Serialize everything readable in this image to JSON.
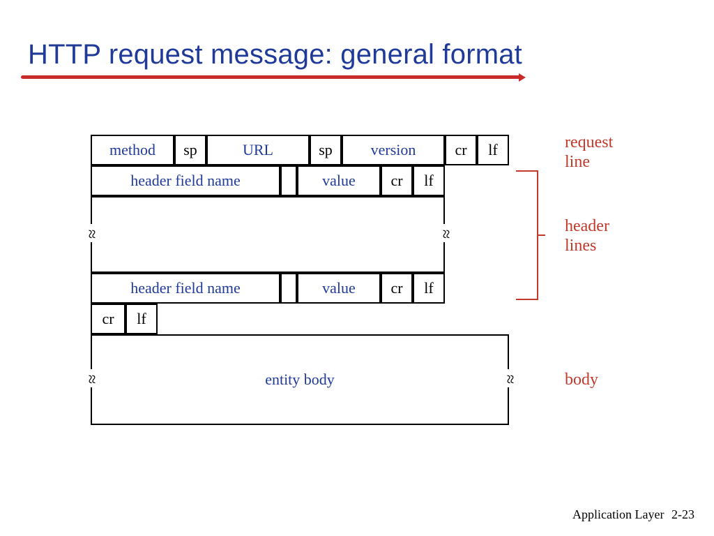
{
  "title": "HTTP request message: general format",
  "row1": {
    "method": "method",
    "sp1": "sp",
    "url": "URL",
    "sp2": "sp",
    "version": "version",
    "cr": "cr",
    "lf": "lf"
  },
  "header1": {
    "name": "header field name",
    "value": "value",
    "cr": "cr",
    "lf": "lf"
  },
  "header2": {
    "name": "header field name",
    "value": "value",
    "cr": "cr",
    "lf": "lf"
  },
  "blank": {
    "cr": "cr",
    "lf": "lf"
  },
  "body": "entity body",
  "ann": {
    "request_line": "request\nline",
    "header_lines": "header\nlines",
    "body": "body"
  },
  "footer": {
    "label": "Application Layer",
    "page": "2-23"
  }
}
